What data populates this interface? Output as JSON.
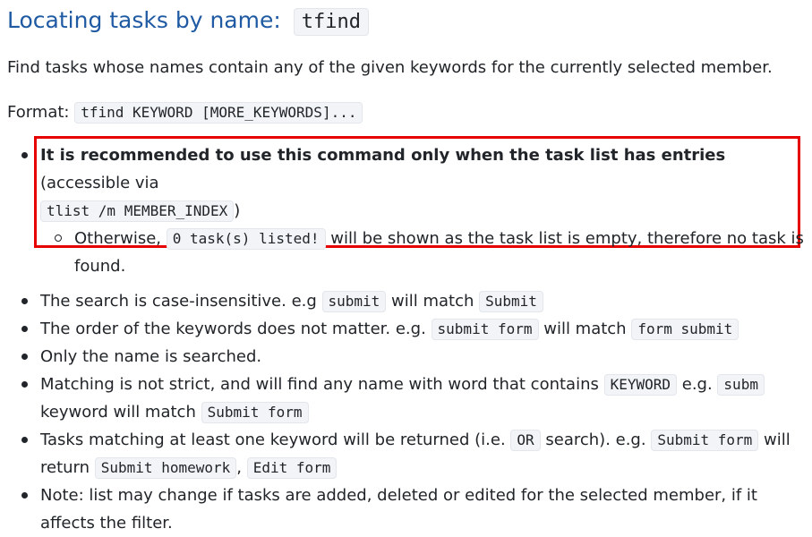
{
  "heading": {
    "text": "Locating tasks by name: ",
    "command": "tfind"
  },
  "intro": "Find tasks whose names contain any of the given keywords for the currently selected member.",
  "format": {
    "label": "Format: ",
    "syntax": "tfind KEYWORD [MORE_KEYWORDS]..."
  },
  "notes": {
    "highlight": {
      "bold": "It is recommended to use this command only when the task list has entries",
      "rest": " (accessible via ",
      "code": "tlist /m MEMBER_INDEX",
      "close": ")",
      "sub": {
        "pre": "Otherwise, ",
        "code": "0 task(s) listed!",
        "post": " will be shown as the task list is empty, therefore no task is found."
      },
      "box_color": "#e60000"
    },
    "case": {
      "pre": "The search is case-insensitive. e.g ",
      "code1": "submit",
      "mid": " will match ",
      "code2": "Submit"
    },
    "order": {
      "pre": "The order of the keywords does not matter. e.g. ",
      "code1": "submit form",
      "mid": " will match ",
      "code2": "form submit"
    },
    "name_only": "Only the name is searched.",
    "strict": {
      "pre": "Matching is not strict, and will find any name with word that contains ",
      "code1": "KEYWORD",
      "mid": " e.g. ",
      "code2": "subm",
      "mid2": " keyword will match ",
      "code3": "Submit form"
    },
    "or_search": {
      "pre": "Tasks matching at least one keyword will be returned (i.e. ",
      "code1": "OR",
      "mid": " search). e.g. ",
      "code2": "Submit form",
      "mid2": " will return ",
      "code3": "Submit homework",
      "sep": ", ",
      "code4": "Edit form"
    },
    "note": "Note: list may change if tasks are added, deleted or edited for the selected member, if it affects the filter."
  },
  "colors": {
    "heading": "#1f5aa3",
    "text": "#212529",
    "code_bg": "#f2f4f7"
  }
}
